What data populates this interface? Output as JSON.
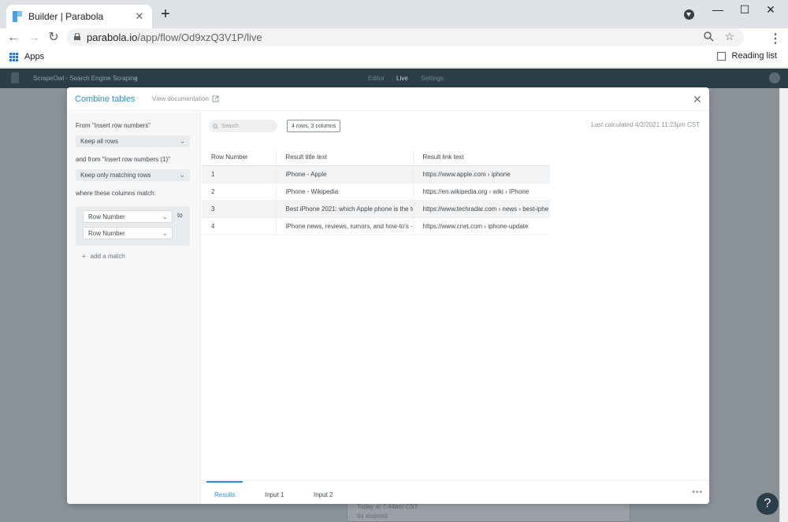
{
  "browser": {
    "tab_title": "Builder | Parabola",
    "tab_close": "✕",
    "new_tab": "+",
    "url_host": "parabola.io",
    "url_path": "/app/flow/Od9xzQ3V1P/live",
    "bookmarks": {
      "apps": "Apps",
      "reading_list": "Reading list"
    },
    "window_controls": {
      "minimize": "—",
      "maximize": "☐",
      "close": "✕"
    }
  },
  "appnav": {
    "flow_name": "ScrapeOwl - Search Engine Scraping",
    "links": [
      "Editor",
      "Live",
      "Settings"
    ],
    "active_link": "Live"
  },
  "background": {
    "line1": "Today at 7:44am CST",
    "line2": "6s elapsed"
  },
  "modal": {
    "title": "Combine tables",
    "view_doc": "View documentation",
    "close": "✕",
    "side": {
      "from_label": "From \"Insert row numbers\"",
      "keep_select": "Keep all rows",
      "and_from_label": "and from \"Insert row numbers (1)\"",
      "keep_matching_select": "Keep only matching rows",
      "where_label": "where these columns match:",
      "match_left": "Row Number",
      "match_right": "Row Number",
      "to_label": "to",
      "add_match": "add a match"
    },
    "content": {
      "search_placeholder": "Search",
      "row_count": "4 rows, 3 columns",
      "last_calculated": "Last calculated 4/2/2021 11:23pm CST",
      "columns": [
        "Row Number",
        "Result title text",
        "Result link text"
      ],
      "rows": [
        [
          "1",
          "iPhone - Apple",
          "https://www.apple.com › iphone"
        ],
        [
          "2",
          "iPhone - Wikipedia",
          "https://en.wikipedia.org › wiki › IPhone"
        ],
        [
          "3",
          "Best iPhone 2021: which Apple phone is the to",
          "https://www.techradar.com › news › best-iphe"
        ],
        [
          "4",
          "iPhone news, reviews, rumors, and how-to's -",
          "https://www.cnet.com › iphone-update"
        ]
      ]
    },
    "footer": {
      "tabs": [
        "Results",
        "Input 1",
        "Input 2"
      ],
      "more": "•••"
    }
  },
  "help": "?"
}
